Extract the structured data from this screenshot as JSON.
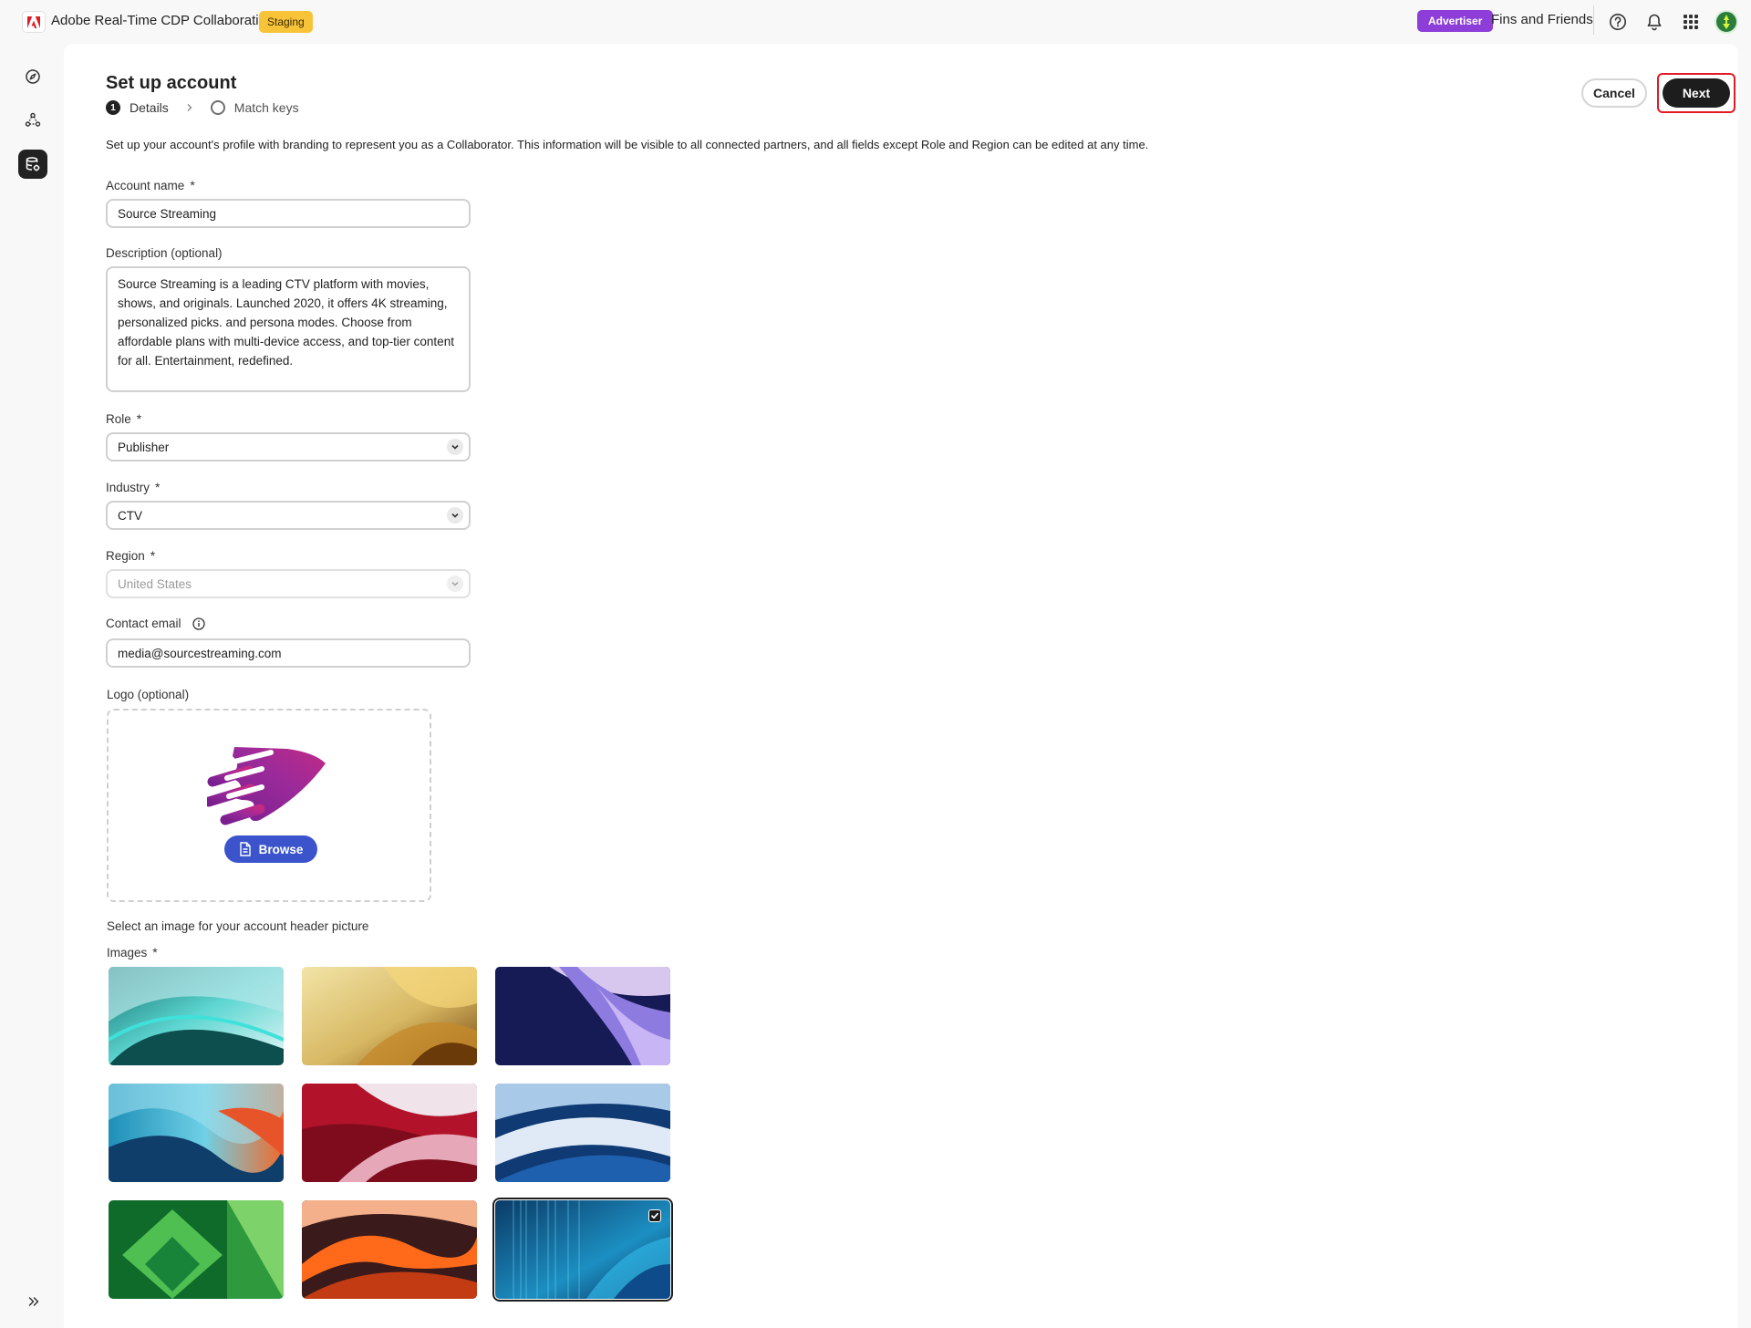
{
  "header": {
    "app_title": "Adobe Real-Time CDP Collaboration",
    "environment_badge": "Staging",
    "role_badge": "Advertiser",
    "org_name": "Fins and Friends",
    "icons": [
      "adobe-logo",
      "help-icon",
      "bell-icon",
      "apps-grid-icon",
      "avatar"
    ]
  },
  "sidebar": {
    "items": [
      {
        "icon": "compass-icon"
      },
      {
        "icon": "connections-icon"
      },
      {
        "icon": "account-setup-icon",
        "active": true
      }
    ],
    "collapse_icon": "double-chevron-right-icon"
  },
  "page": {
    "title": "Set up account",
    "steps": [
      {
        "number": "1",
        "label": "Details",
        "active": true
      },
      {
        "label": "Match keys",
        "active": false
      }
    ],
    "cancel_label": "Cancel",
    "next_label": "Next",
    "intro": "Set up your account's profile with branding to represent you as a Collaborator. This information will be visible to all connected partners, and all fields except Role and Region can be edited at any time."
  },
  "form": {
    "account_name": {
      "label": "Account name",
      "required_mark": "*",
      "value": "Source Streaming"
    },
    "description": {
      "label": "Description (optional)",
      "value": "Source Streaming is a leading CTV platform with movies, shows, and originals. Launched 2020, it offers 4K streaming, personalized picks. and persona modes. Choose from affordable plans with multi-device access, and top-tier content for all. Entertainment, redefined."
    },
    "role": {
      "label": "Role",
      "required_mark": "*",
      "value": "Publisher"
    },
    "industry": {
      "label": "Industry",
      "required_mark": "*",
      "value": "CTV"
    },
    "region": {
      "label": "Region",
      "required_mark": "*",
      "value": "United States",
      "disabled": true
    },
    "contact_email": {
      "label": "Contact email",
      "value": "media@sourcestreaming.com"
    },
    "logo": {
      "label": "Logo (optional)",
      "browse_label": "Browse"
    },
    "images": {
      "prompt": "Select an image for your account header picture",
      "label": "Images",
      "required_mark": "*",
      "selected_index": 8,
      "count": 9
    }
  },
  "colors": {
    "accent_blue": "#3b54cc",
    "advertiser_purple": "#8e3ed8",
    "staging_yellow": "#f7c339",
    "highlight_red": "#e01b24",
    "primary_dark": "#1d1d1d"
  }
}
